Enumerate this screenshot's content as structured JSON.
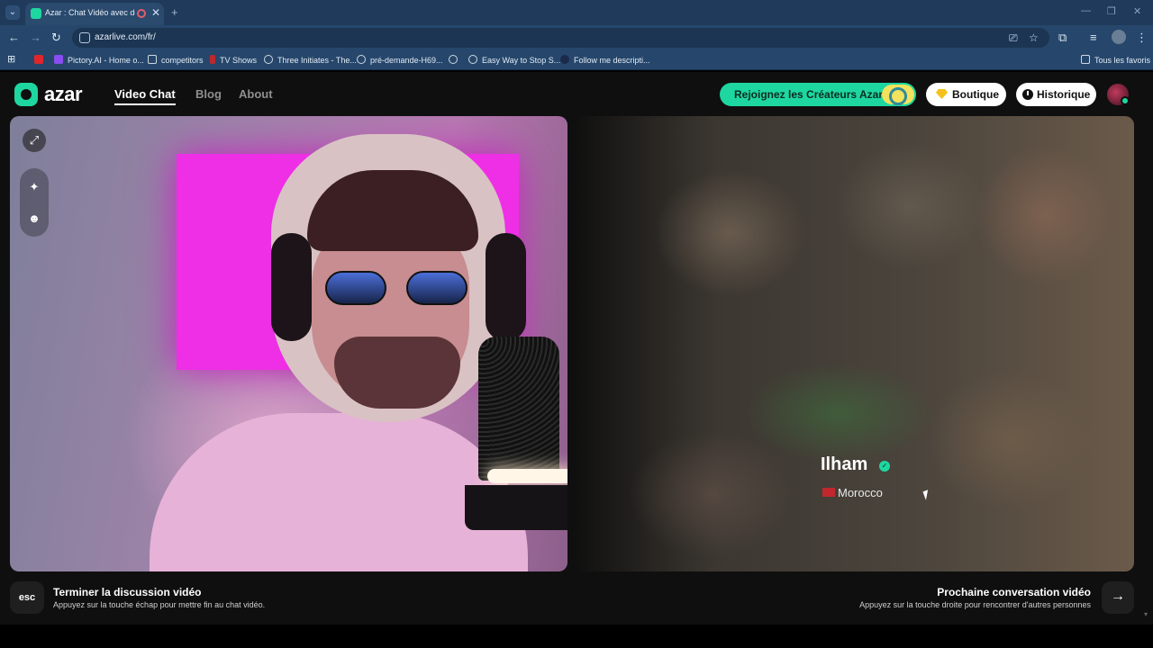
{
  "browser": {
    "tab_title": "Azar : Chat Vidéo avec de n",
    "url": "azarlive.com/fr/",
    "bookmarks": [
      {
        "label": "Pictory.AI - Home o...",
        "color": "#8a4df0"
      },
      {
        "label": "competitors",
        "color": "#cfd8e3"
      },
      {
        "label": "TV Shows",
        "color": "#c0282d"
      },
      {
        "label": "Three Initiates - The...",
        "color": "#cfd8e3"
      },
      {
        "label": "pré-demande-H69...",
        "color": "#cfd8e3"
      },
      {
        "label": "Easy Way to Stop S...",
        "color": "#cfd8e3"
      },
      {
        "label": "Follow me descripti...",
        "color": "#1b2a4a"
      }
    ],
    "all_bookmarks": "Tous les favoris"
  },
  "site": {
    "logo": "azar",
    "nav": {
      "video_chat": "Video Chat",
      "blog": "Blog",
      "about": "About"
    },
    "creators_button": "Rejoignez les Créateurs Azar",
    "shop_button": "Boutique",
    "history_button": "Historique",
    "accent_color": "#1ed7a0"
  },
  "peer": {
    "name": "Ilham",
    "country": "Morocco"
  },
  "footer": {
    "esc_key": "esc",
    "end_title": "Terminer la discussion vidéo",
    "end_sub": "Appuyez sur la touche échap pour mettre fin au chat vidéo.",
    "next_title": "Prochaine conversation vidéo",
    "next_sub": "Appuyez sur la touche droite pour rencontrer d'autres personnes"
  }
}
